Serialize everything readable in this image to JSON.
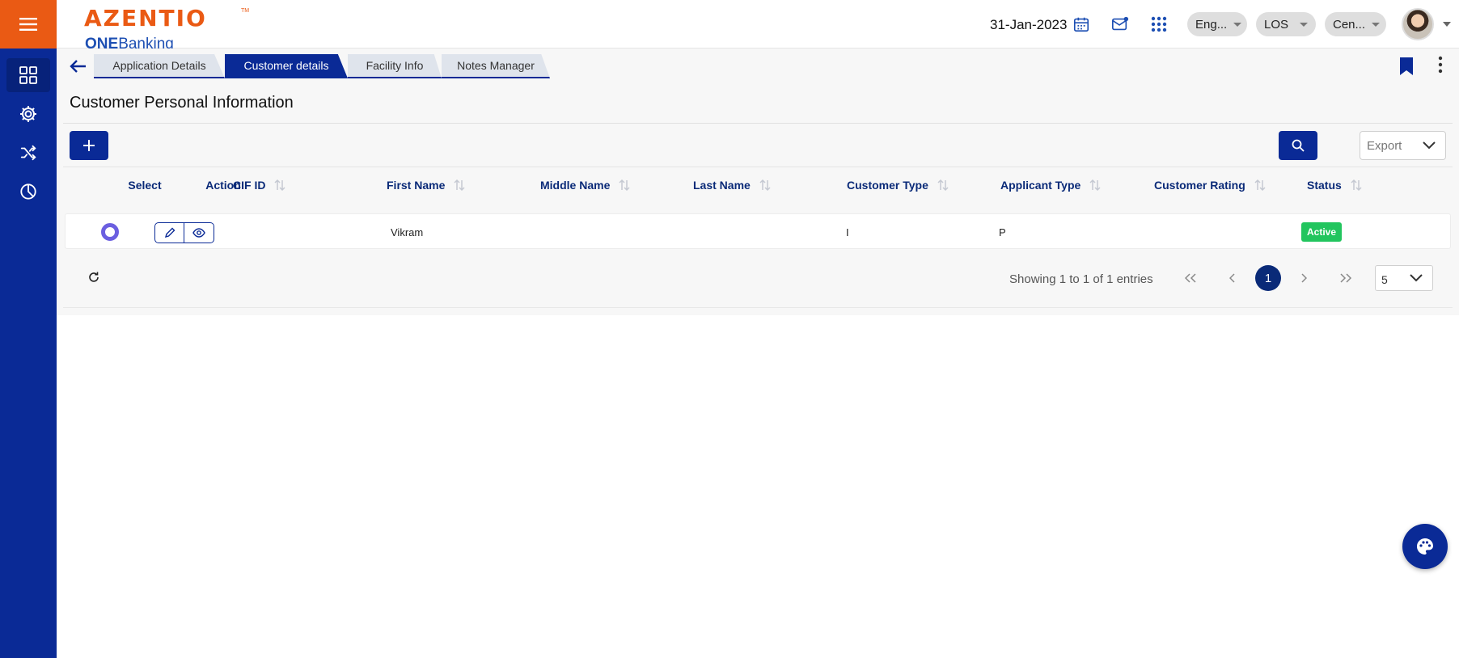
{
  "header": {
    "logo_main": "AZENTIO",
    "logo_tm": "TM",
    "logo_sub_bold": "ONE",
    "logo_sub_rest": "Banking",
    "date": "31-Jan-2023",
    "pills": [
      "Eng...",
      "LOS",
      "Cen..."
    ]
  },
  "sidebar": {
    "items": [
      {
        "icon": "grid-icon",
        "active": true
      },
      {
        "icon": "gear-icon",
        "active": false
      },
      {
        "icon": "shuffle-icon",
        "active": false
      },
      {
        "icon": "pie-chart-icon",
        "active": false
      }
    ]
  },
  "tabs": [
    {
      "label": "Application Details",
      "active": false
    },
    {
      "label": "Customer details",
      "active": true
    },
    {
      "label": "Facility Info",
      "active": false
    },
    {
      "label": "Notes Manager",
      "active": false
    }
  ],
  "section_title": "Customer Personal Information",
  "toolbar": {
    "export_label": "Export"
  },
  "table": {
    "columns": [
      "Select",
      "Action",
      "CIF ID",
      "First Name",
      "Middle Name",
      "Last Name",
      "Customer Type",
      "Applicant Type",
      "Customer Rating",
      "Status"
    ],
    "rows": [
      {
        "cif_id": "",
        "first_name": "Vikram",
        "middle_name": "",
        "last_name": "",
        "customer_type": "I",
        "applicant_type": "P",
        "customer_rating": "",
        "status": "Active"
      }
    ]
  },
  "pagination": {
    "showing": "Showing 1 to 1 of 1 entries",
    "current_page": "1",
    "page_size": "5"
  },
  "colors": {
    "brand_orange": "#ea5a14",
    "brand_blue": "#0a2a96",
    "status_active": "#22c55e"
  }
}
